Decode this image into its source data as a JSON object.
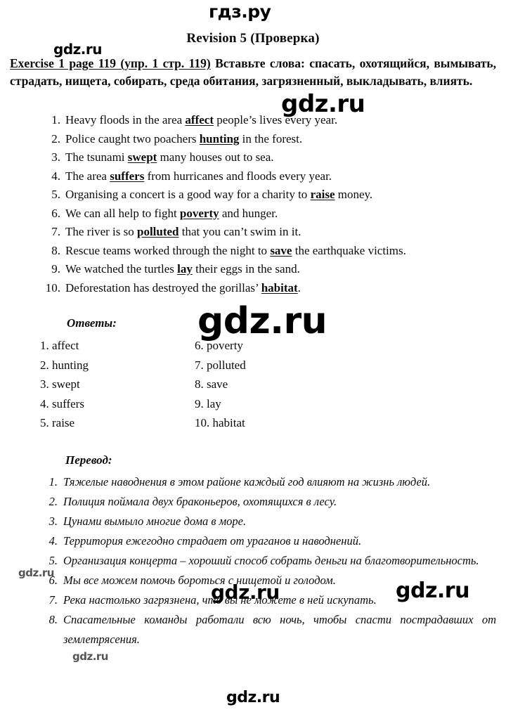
{
  "watermarks": {
    "top": "гдз.ру",
    "near_exercise": "gdz.ru",
    "line1": "gdz.ru",
    "center": "gdz.ru",
    "small_item5": "gdz.ru",
    "mid_left": "gdz.ru",
    "mid_right": "gdz.ru",
    "small_item8": "gdz.ru",
    "bottom": "gdz.ru"
  },
  "page": {
    "title": "Revision 5 (Проверка)",
    "instruction": {
      "underlined": "Exercise 1 page 119 (упр. 1 стр. 119)",
      "rest": " Вставьте слова: спасать, охотящийся, вымывать, страдать, нищета, собирать, среда обитания, загрязненный, выкладывать, влиять."
    },
    "sentences": [
      {
        "num": "1.",
        "before": "Heavy floods in the area ",
        "key": "affect",
        "after": " people’s lives every year."
      },
      {
        "num": "2.",
        "before": "Police caught two poachers ",
        "key": "hunting",
        "after": " in the forest."
      },
      {
        "num": "3.",
        "before": "The tsunami ",
        "key": "swept",
        "after": " many houses out to sea."
      },
      {
        "num": "4.",
        "before": "The area ",
        "key": "suffers",
        "after": " from hurricanes and floods every year."
      },
      {
        "num": "5.",
        "before": "Organising a concert is a good way for a charity to ",
        "key": "raise",
        "after": " money."
      },
      {
        "num": "6.",
        "before": "We can all help to fight ",
        "key": "poverty",
        "after": " and hunger."
      },
      {
        "num": "7.",
        "before": "The river is so ",
        "key": "polluted",
        "after": " that you can’t swim in it."
      },
      {
        "num": "8.",
        "before": "Rescue teams worked through the night to ",
        "key": "save",
        "after": " the earthquake victims."
      },
      {
        "num": "9.",
        "before": "We watched the turtles ",
        "key": "lay",
        "after": " their eggs in the sand."
      },
      {
        "num": "10.",
        "before": "Deforestation has destroyed the gorillas’ ",
        "key": "habitat",
        "after": "."
      }
    ],
    "answers_heading": "Ответы:",
    "answers_left": [
      "1. affect",
      "2. hunting",
      "3. swept",
      "4. suffers",
      "5. raise"
    ],
    "answers_right": [
      "6. poverty",
      "7. polluted",
      "8. save",
      "9. lay",
      "10. habitat"
    ],
    "translation_heading": "Перевод:",
    "translation": [
      {
        "num": "1.",
        "text": "Тяжелые наводнения в этом районе каждый год влияют на жизнь людей.",
        "justify": true
      },
      {
        "num": "2.",
        "text": "Полиция поймала двух браконьеров, охотящихся в лесу.",
        "justify": false
      },
      {
        "num": "3.",
        "text": "Цунами вымыло многие дома в море.",
        "justify": false
      },
      {
        "num": "4.",
        "text": "Территория ежегодно страдает от ураганов и наводнений.",
        "justify": false
      },
      {
        "num": "5.",
        "text": "Организация концерта – хороший способ собрать деньги на благотворительность.",
        "justify": true
      },
      {
        "num": "6.",
        "text": "Мы все можем помочь бороться с нищетой и голодом.",
        "justify": false
      },
      {
        "num": "7.",
        "text": "Река настолько загрязнена, что вы не можете в ней искупать.",
        "justify": false
      },
      {
        "num": "8.",
        "text": "Спасательные команды работали всю ночь, чтобы спасти пострадавших от землетрясения.",
        "justify": true
      }
    ]
  }
}
